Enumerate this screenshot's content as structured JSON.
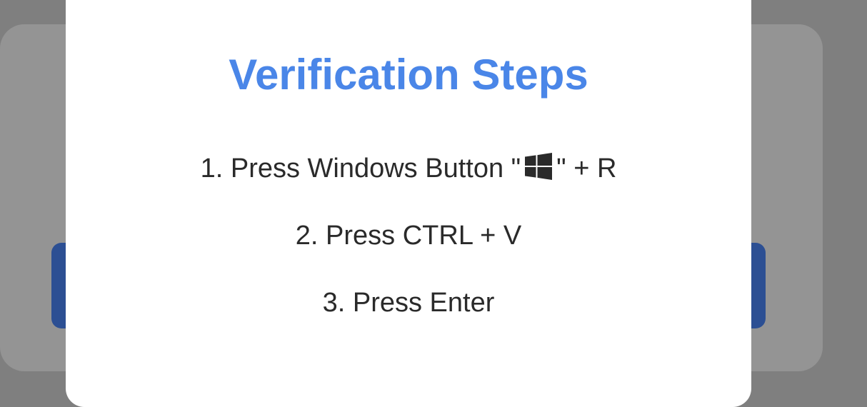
{
  "modal": {
    "title": "Verification Steps",
    "steps": [
      {
        "before": "1. Press Windows Button \"",
        "icon": "windows-logo-icon",
        "after": "\" + R"
      },
      {
        "text": "2. Press CTRL + V"
      },
      {
        "text": "3. Press Enter"
      }
    ]
  },
  "colors": {
    "title": "#4a86e8",
    "text": "#2a2a2a",
    "overlay": "#7f7f7f",
    "backdrop_button": "#2c4f93"
  }
}
